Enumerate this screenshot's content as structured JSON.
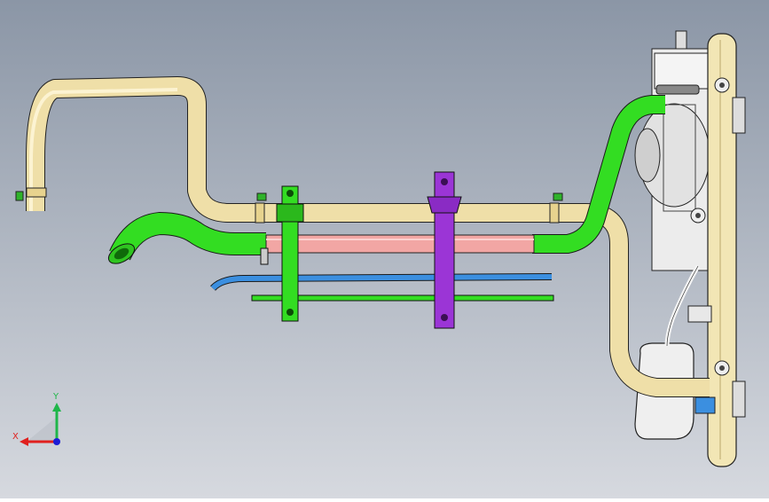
{
  "triad": {
    "x_label": "X",
    "y_label": "Y",
    "colors": {
      "x": "#e0201e",
      "y": "#1fb64a",
      "z": "#1c1cd6"
    }
  },
  "palette": {
    "background_top": "#8b96a6",
    "background_bottom": "#d6d9df",
    "cream_pipe": "#efdfa8",
    "green_hose": "#33dd22",
    "purple_bracket": "#9b35d6",
    "pink_pipe": "#f2a6a4",
    "blue_tube": "#3b8fe0",
    "radiator_frame": "#f2e6b5",
    "fan_grey": "#dcdcdc"
  }
}
